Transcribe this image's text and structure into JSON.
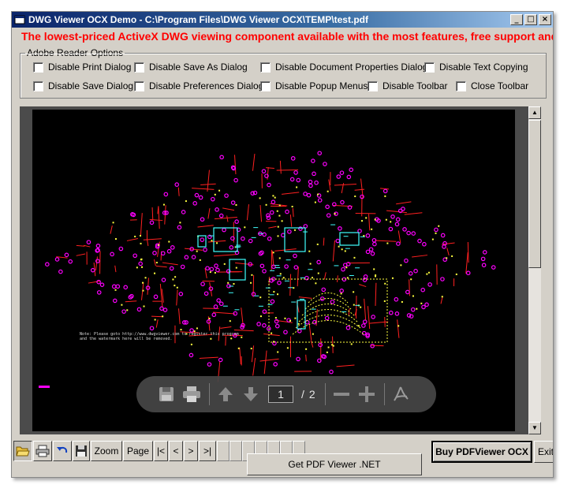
{
  "window": {
    "title": "DWG Viewer OCX Demo - C:\\Program Files\\DWG Viewer OCX\\TEMP\\test.pdf",
    "minimize": "_",
    "maximize": "□",
    "close": "×"
  },
  "banner": "The lowest-priced ActiveX DWG viewing component available with the most features, free support and",
  "options": {
    "legend": "Adobe Reader Options",
    "items": [
      {
        "label": "Disable Print Dialog"
      },
      {
        "label": "Disable Save As Dialog"
      },
      {
        "label": "Disable Document Properties Dialog"
      },
      {
        "label": "Disable Text Copying"
      },
      {
        "label": "Disable Save Dialog"
      },
      {
        "label": "Disable Preferences Dialog"
      },
      {
        "label": "Disable Popup Menus"
      },
      {
        "label": "Disable Toolbar"
      },
      {
        "label": "Close Toolbar"
      }
    ]
  },
  "viewer": {
    "current_page": "1",
    "page_separator": "/",
    "total_pages": "2",
    "note_text": "Note: Please goto http://www.dwgviewer.com to register this program\nand the watermark here will be removed."
  },
  "bottom": {
    "zoom": "Zoom",
    "page": "Page",
    "first": "|<",
    "prev": "<",
    "next": ">",
    "last": ">|",
    "get_pdf": "Get PDF Viewer .NET",
    "buy": "Buy PDFViewer OCX",
    "exit": "Exit"
  },
  "colors": {
    "banner": "#ff0000",
    "titlebar": "#0a246a",
    "drawing_magenta": "#ff00ff",
    "drawing_red": "#ff2020",
    "drawing_yellow": "#ffff40",
    "drawing_cyan": "#40ffff"
  }
}
